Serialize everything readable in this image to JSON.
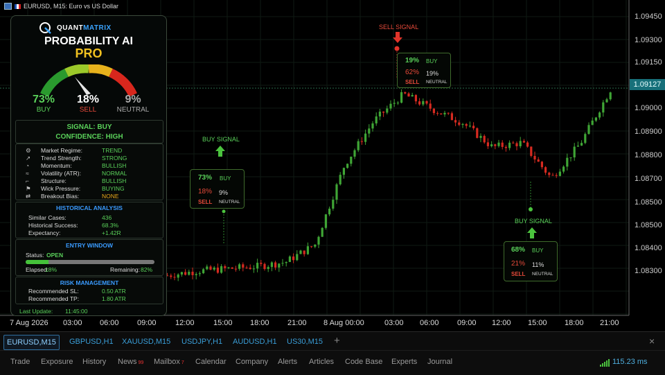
{
  "window": {
    "title": "EURUSD, M15:  Euro vs US Dollar"
  },
  "chart": {
    "y_ticks": [
      "1.09450",
      "1.09300",
      "1.09150",
      "1.09000",
      "1.08900",
      "1.08800",
      "1.08700",
      "1.08500",
      "1.08500",
      "1.08400",
      "1.08300"
    ],
    "current_price": "1.09127",
    "x_ticks": [
      "7 Aug 2026",
      "03:00",
      "06:00",
      "09:00",
      "12:00",
      "15:00",
      "18:00",
      "21:00",
      "8 Aug 00:00",
      "03:00",
      "06:00",
      "09:00",
      "12:00",
      "15:00",
      "18:00",
      "21:00"
    ],
    "colors": {
      "bull": "#3fa535",
      "bear": "#d62a20",
      "grid": "#1a2a1f"
    }
  },
  "chart_data": {
    "type": "line",
    "title": "",
    "xlabel": "",
    "ylabel": "",
    "x": [
      "7 Aug 2026",
      "03:00",
      "06:00",
      "09:00",
      "12:00",
      "15:00",
      "18:00",
      "21:00",
      "8 Aug 00:00",
      "03:00",
      "06:00",
      "09:00",
      "12:00",
      "15:00",
      "18:00",
      "21:00"
    ],
    "series": [
      {
        "values": [
          1.0828,
          1.083,
          1.0831,
          1.0832,
          1.0834,
          1.0842,
          1.0878,
          1.0898,
          1.091,
          1.0903,
          1.0897,
          1.0886,
          1.0888,
          1.0872,
          1.0888,
          1.0912
        ]
      }
    ],
    "ylim": [
      1.082,
      1.095
    ],
    "current_price": 1.09127,
    "grid": false
  },
  "panel": {
    "brand": "QUANTMATRIX",
    "brand_hl": "MATRIX",
    "brand_main": "QUANT",
    "product": "PROBABILITY AI",
    "edition": "PRO",
    "buy_pct": "73%",
    "buy_label": "BUY",
    "sell_pct": "18%",
    "sell_label": "SELL",
    "neutral_pct": "9%",
    "neutral_label": "NEUTRAL",
    "gauge_value": 0.73,
    "signal": "SIGNAL: BUY",
    "confidence": "CONFIDENCE: HIGH",
    "metrics": [
      {
        "icon": "gear-icon",
        "label": "Market Regime:",
        "value": "TREND",
        "color": "#5ad15a"
      },
      {
        "icon": "trend-icon",
        "label": "Trend Strength:",
        "value": "STRONG",
        "color": "#5ad15a"
      },
      {
        "icon": "speed-icon",
        "label": "Momentum:",
        "value": "BULLISH",
        "color": "#5ad15a"
      },
      {
        "icon": "wave-icon",
        "label": "Volatility (ATR):",
        "value": "NORMAL",
        "color": "#5ad15a"
      },
      {
        "icon": "structure-icon",
        "label": "Structure:",
        "value": "BULLISH",
        "color": "#5ad15a"
      },
      {
        "icon": "wick-icon",
        "label": "Wick Pressure:",
        "value": "BUYING",
        "color": "#5ad15a"
      },
      {
        "icon": "breakout-icon",
        "label": "Breakout Bias:",
        "value": "NONE",
        "color": "#e8a81b"
      }
    ],
    "history_title": "HISTORICAL ANALYSIS",
    "history": [
      {
        "label": "Similar Cases:",
        "value": "436"
      },
      {
        "label": "Historical Success:",
        "value": "68.3%"
      },
      {
        "label": "Expectancy:",
        "value": "+1.42R"
      }
    ],
    "entry_title": "ENTRY WINDOW",
    "status_label": "Status:",
    "status_value": "OPEN",
    "elapsed_label": "Elapsed:",
    "elapsed_value": "18%",
    "remaining_label": "Remaining:",
    "remaining_value": "82%",
    "elapsed_fraction": 0.18,
    "risk_title": "RISK MANAGEMENT",
    "risk": [
      {
        "label": "Recommended SL:",
        "value": "0.50 ATR"
      },
      {
        "label": "Recommended TP:",
        "value": "1.80 ATR"
      }
    ],
    "last_update_label": "Last Update:",
    "last_update_value": "11:45:00"
  },
  "signals": [
    {
      "title": "BUY SIGNAL",
      "buy": "73%",
      "buy_label": "BUY",
      "sell": "18%",
      "sell_label": "SELL",
      "neutral": "9%",
      "neutral_label": "NEUTRAL"
    },
    {
      "title": "SELL SIGNAL",
      "buy": "19%",
      "buy_label": "BUY",
      "sell": "62%",
      "sell_label": "SELL",
      "neutral": "19%",
      "neutral_label": "NEUTRAL"
    },
    {
      "title": "BUY SIGNAL",
      "buy": "68%",
      "buy_label": "BUY",
      "sell": "21%",
      "sell_label": "SELL",
      "neutral": "11%",
      "neutral_label": "NEUTRAL"
    }
  ],
  "tabs": [
    "EURUSD,M15",
    "GBPUSD,H1",
    "XAUUSD,M15",
    "USDJPY,H1",
    "AUDUSD,H1",
    "US30,M15"
  ],
  "add_tab": "+",
  "close_tabs": "×",
  "bottom": {
    "items": [
      "Trade",
      "Exposure",
      "History",
      "News",
      "Mailbox",
      "Calendar",
      "Company",
      "Alerts",
      "Articles",
      "Code Base",
      "Experts",
      "Journal"
    ],
    "news_badge": "99",
    "mailbox_badge": "7",
    "ping": "115.23 ms"
  }
}
